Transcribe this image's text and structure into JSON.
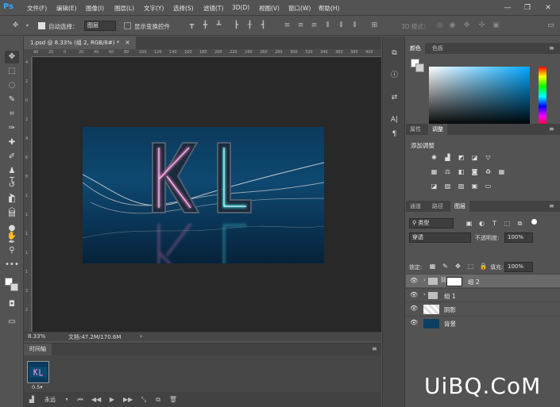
{
  "app": {
    "logo": "Ps"
  },
  "menu": [
    "文件(F)",
    "编辑(E)",
    "图像(I)",
    "图层(L)",
    "文字(Y)",
    "选择(S)",
    "滤镜(T)",
    "3D(D)",
    "视图(V)",
    "窗口(W)",
    "帮助(H)"
  ],
  "window_controls": {
    "minimize": "—",
    "restore": "❐",
    "close": "✕"
  },
  "options": {
    "auto_select_label": "自动选择：",
    "auto_select_value": "图层",
    "show_transform_label": "显示变换控件",
    "mode_3d_label": "3D 模式："
  },
  "document": {
    "tab_title": "1.psd @ 8.33% (组 2, RGB/8#) *",
    "ruler_h": [
      "40",
      "20",
      "0",
      "20",
      "40",
      "60",
      "80",
      "100",
      "120",
      "140",
      "160",
      "180",
      "200",
      "220",
      "240",
      "260",
      "280",
      "300",
      "320",
      "340",
      "360",
      "380",
      "400"
    ],
    "ruler_v": [
      "4",
      "2",
      "0",
      "2",
      "4",
      "6",
      "8",
      "1",
      "1",
      "1",
      "1",
      "1",
      "2",
      "2"
    ],
    "zoom": "8.33%",
    "doc_size": "文档:47.2M/170.6M",
    "artwork_text": "KL"
  },
  "timeline": {
    "title": "时间轴",
    "frame_label": "0.5▾",
    "loop": "永远"
  },
  "color_panel": {
    "tabs": [
      "颜色",
      "色板"
    ]
  },
  "adjust_panel": {
    "tabs": [
      "属性",
      "调整"
    ],
    "add_label": "添加调整"
  },
  "layers_panel": {
    "tabs": [
      "通道",
      "路径",
      "图层"
    ],
    "filter_type": "类型",
    "blend_mode": "穿透",
    "opacity_label": "不透明度:",
    "opacity_value": "100%",
    "lock_label": "锁定:",
    "fill_label": "填充:",
    "fill_value": "100%",
    "layers": [
      {
        "name": "组 2",
        "type": "group",
        "selected": true
      },
      {
        "name": "组 1",
        "type": "group",
        "selected": false
      },
      {
        "name": "阴影",
        "type": "layer",
        "selected": false
      },
      {
        "name": "背景",
        "type": "layer",
        "selected": false
      }
    ]
  },
  "watermark": "UiBQ.CoM",
  "colors": {
    "accent": "#31a8ff",
    "panel": "#535353",
    "canvas_bg": "#282828"
  }
}
